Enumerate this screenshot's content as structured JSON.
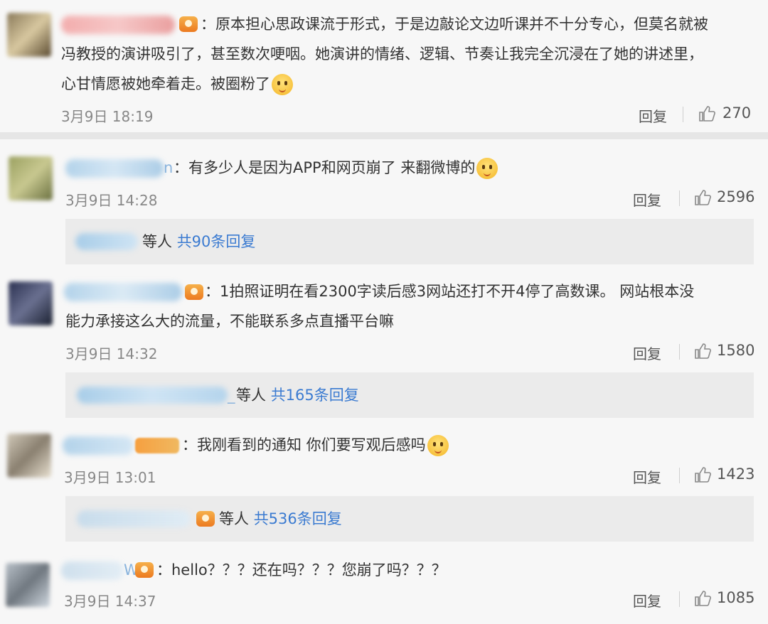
{
  "comments": [
    {
      "colon": "：",
      "text_lines": [
        "原本担心思政课流于形式，于是边敲论文边听课并不十分专心，但莫名就被",
        "冯教授的演讲吸引了，甚至数次哽咽。她演讲的情绪、逻辑、节奏让我完全沉浸在了她的讲述里，",
        "心甘情愿被她牵着走。被圈粉了"
      ],
      "time": "3月9日 18:19",
      "reply_label": "回复",
      "likes": "270",
      "emoji": "smile-emoji",
      "badge": "vip-badge"
    },
    {
      "colon": "：",
      "name_suffix": "n",
      "text_lines": [
        "有多少人是因为APP和网页崩了 来翻微博的"
      ],
      "time": "3月9日 14:28",
      "reply_label": "回复",
      "likes": "2596",
      "emoji": "doge-emoji",
      "sub_reply": {
        "others": "等人",
        "count_link": "共90条回复"
      }
    },
    {
      "colon": "：",
      "text_lines": [
        "1拍照证明在看2300字读后感3网站还打不开4停了高数课。 网站根本没",
        "能力承接这么大的流量，不能联系多点直播平台嘛"
      ],
      "time": "3月9日 14:32",
      "reply_label": "回复",
      "likes": "1580",
      "badge": "vip-badge",
      "sub_reply": {
        "others": "等人",
        "count_link": "共165条回复",
        "name_tail": "_"
      }
    },
    {
      "colon": "：",
      "text_lines": [
        "我刚看到的通知 你们要写观后感吗"
      ],
      "time": "3月9日 13:01",
      "reply_label": "回复",
      "likes": "1423",
      "emoji": "smile-emoji",
      "badge": "fan-badge",
      "sub_reply": {
        "others": "等人",
        "count_link": "共536条回复"
      }
    },
    {
      "colon": "：",
      "name_suffix": "W",
      "text_lines": [
        "hello？？？还在吗？？？您崩了吗？？？"
      ],
      "time": "3月9日 14:37",
      "reply_label": "回复",
      "likes": "1085",
      "badge": "vip-badge"
    }
  ],
  "colors": {
    "link": "#3b7bd1",
    "background": "#f7f7f7",
    "subreply_bg": "#ebebeb"
  }
}
